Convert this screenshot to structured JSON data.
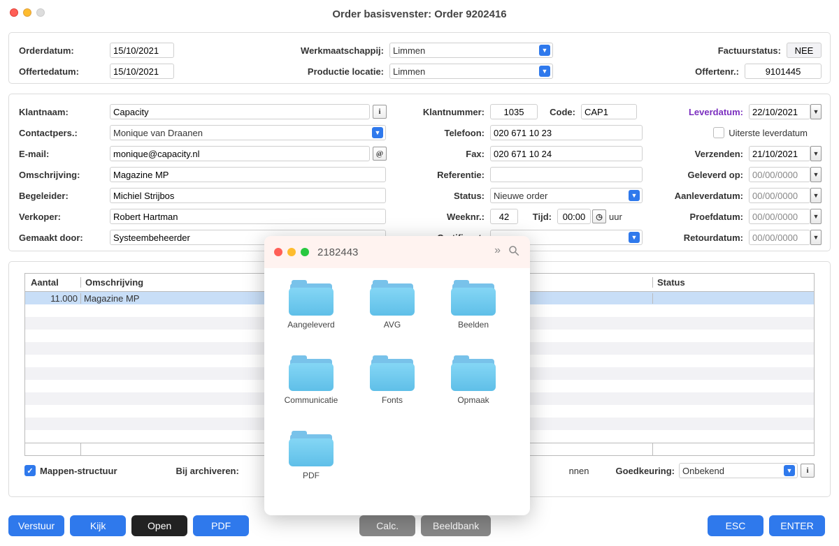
{
  "window": {
    "title": "Order basisvenster: Order 9202416"
  },
  "top": {
    "orderdatum_label": "Orderdatum:",
    "orderdatum_value": "15/10/2021",
    "offertedatum_label": "Offertedatum:",
    "offertedatum_value": "15/10/2021",
    "werkmaatschappij_label": "Werkmaatschappij:",
    "werkmaatschappij_value": "Limmen",
    "productie_locatie_label": "Productie locatie:",
    "productie_locatie_value": "Limmen",
    "factuurstatus_label": "Factuurstatus:",
    "factuurstatus_value": "NEE",
    "offertenr_label": "Offertenr.:",
    "offertenr_value": "9101445"
  },
  "mid": {
    "klantnaam_label": "Klantnaam:",
    "klantnaam_value": "Capacity",
    "contactpers_label": "Contactpers.:",
    "contactpers_value": "Monique van Draanen",
    "email_label": "E-mail:",
    "email_value": "monique@capacity.nl",
    "omschrijving_label": "Omschrijving:",
    "omschrijving_value": "Magazine MP",
    "begeleider_label": "Begeleider:",
    "begeleider_value": "Michiel Strijbos",
    "verkoper_label": "Verkoper:",
    "verkoper_value": "Robert Hartman",
    "gemaakt_door_label": "Gemaakt door:",
    "gemaakt_door_value": "Systeembeheerder",
    "klantnummer_label": "Klantnummer:",
    "klantnummer_value": "1035",
    "code_label": "Code:",
    "code_value": "CAP1",
    "telefoon_label": "Telefoon:",
    "telefoon_value": "020 671 10 23",
    "fax_label": "Fax:",
    "fax_value": "020 671 10 24",
    "referentie_label": "Referentie:",
    "referentie_value": "",
    "status_label": "Status:",
    "status_value": "Nieuwe order",
    "weeknr_label": "Weeknr.:",
    "weeknr_value": "42",
    "tijd_label": "Tijd:",
    "tijd_value": "00:00",
    "tijd_unit": "uur",
    "certificaat_label": "Certificaat:",
    "certificaat_value": "",
    "leverdatum_label": "Leverdatum:",
    "leverdatum_value": "22/10/2021",
    "uiterste_label": "Uiterste leverdatum",
    "verzenden_label": "Verzenden:",
    "verzenden_value": "21/10/2021",
    "geleverd_label": "Geleverd op:",
    "geleverd_value": "00/00/0000",
    "aanlever_label": "Aanleverdatum:",
    "aanlever_value": "00/00/0000",
    "proef_label": "Proefdatum:",
    "proef_value": "00/00/0000",
    "retour_label": "Retourdatum:",
    "retour_value": "00/00/0000"
  },
  "table": {
    "col_aantal": "Aantal",
    "col_omschrijving": "Omschrijving",
    "col_status": "Status",
    "row1_aantal": "11.000",
    "row1_omschrijving": "Magazine MP",
    "row1_status": ""
  },
  "opts": {
    "mappen_structuur": "Mappen-structuur",
    "bij_archiveren": "Bij archiveren:",
    "goedkeuring_label": "Goedkeuring:",
    "goedkeuring_value": "Onbekend",
    "scannen": "nnen"
  },
  "footer": {
    "verstuur": "Verstuur",
    "kijk": "Kijk",
    "open": "Open",
    "pdf": "PDF",
    "calc": "Calc.",
    "beeldbank": "Beeldbank",
    "esc": "ESC",
    "enter": "ENTER"
  },
  "popup": {
    "title": "2182443",
    "folders": {
      "f1": "Aangeleverd",
      "f2": "AVG",
      "f3": "Beelden",
      "f4": "Communicatie",
      "f5": "Fonts",
      "f6": "Opmaak",
      "f7": "PDF"
    }
  }
}
